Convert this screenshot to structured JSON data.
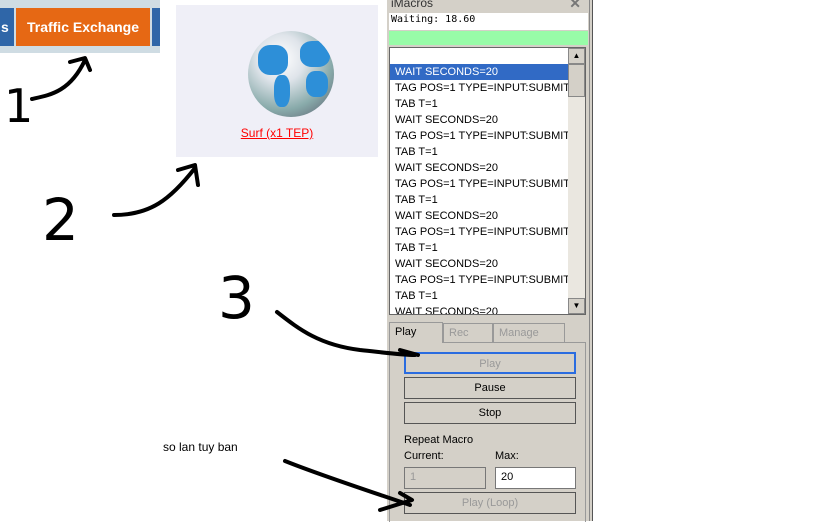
{
  "nav": {
    "prev_label": "s",
    "active_label": "Traffic Exchange",
    "active_color": "#e66814"
  },
  "surf": {
    "icon": "globe-icon",
    "link": "Surf (x1 TEP)"
  },
  "imacros": {
    "title": "iMacros",
    "status": "Waiting: 18.60",
    "progress_color": "#98fca8",
    "lines": [
      "",
      "WAIT SECONDS=20",
      "TAG POS=1 TYPE=INPUT:SUBMIT...",
      "TAB T=1",
      "WAIT SECONDS=20",
      "TAG POS=1 TYPE=INPUT:SUBMIT...",
      "TAB T=1",
      "WAIT SECONDS=20",
      "TAG POS=1 TYPE=INPUT:SUBMIT...",
      "TAB T=1",
      "WAIT SECONDS=20",
      "TAG POS=1 TYPE=INPUT:SUBMIT...",
      "TAB T=1",
      "WAIT SECONDS=20",
      "TAG POS=1 TYPE=INPUT:SUBMIT...",
      "TAB T=1",
      "WAIT SECONDS=20"
    ],
    "tabs": [
      "Play",
      "Rec",
      "Manage"
    ],
    "buttons": {
      "play": "Play",
      "pause": "Pause",
      "stop": "Stop",
      "loop": "Play (Loop)"
    },
    "repeat_label": "Repeat Macro",
    "current_label": "Current:",
    "current_value": "1",
    "max_label": "Max:",
    "max_value": "20"
  },
  "annotations": {
    "n1": "1",
    "n2": "2",
    "n3": "3",
    "note": "so lan tuy ban"
  }
}
